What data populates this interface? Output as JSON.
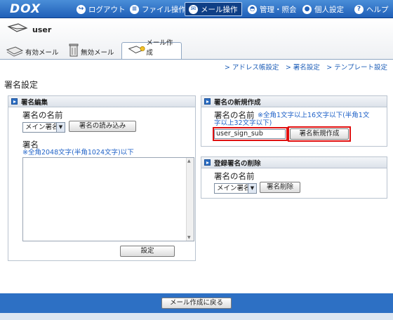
{
  "header": {
    "logo": "DOX",
    "nav": [
      {
        "label": "ログアウト",
        "icon": "logout-icon"
      },
      {
        "label": "ファイル操作",
        "icon": "file-icon"
      },
      {
        "label": "メール操作",
        "icon": "mail-icon"
      },
      {
        "label": "管理・照会",
        "icon": "admin-icon"
      },
      {
        "label": "個人設定",
        "icon": "person-icon"
      },
      {
        "label": "ヘルプ",
        "icon": "help-icon"
      }
    ]
  },
  "user": {
    "name": "user"
  },
  "tabs": [
    {
      "label": "有効メール"
    },
    {
      "label": "無効メール"
    },
    {
      "label": "メール作成"
    }
  ],
  "links": {
    "text": "> アドレス帳設定　> 署名設定　> テンプレート設定"
  },
  "page_title": "署名設定",
  "edit_panel": {
    "title": "署名編集",
    "name_label": "署名の名前",
    "select_value": "メイン署名",
    "load_button": "署名の読み込み",
    "sig_label": "署名",
    "sig_note": "※全角2048文字(半角1024文字)以下",
    "save_button": "設定"
  },
  "new_panel": {
    "title": "署名の新規作成",
    "name_label": "署名の名前",
    "note_1": "※全角1文字以上16文字以下(半角1文",
    "note_2": "字以上32文字以下)",
    "input_value": "user_sign_sub",
    "create_button": "署名新規作成"
  },
  "delete_panel": {
    "title": "登録署名の削除",
    "name_label": "署名の名前",
    "select_value": "メイン署名",
    "delete_button": "署名削除"
  },
  "footer": {
    "back_button": "メール作成に戻る"
  },
  "colors": {
    "header": "#2d70c4",
    "highlight": "#e01010",
    "note": "#1f62c8"
  }
}
